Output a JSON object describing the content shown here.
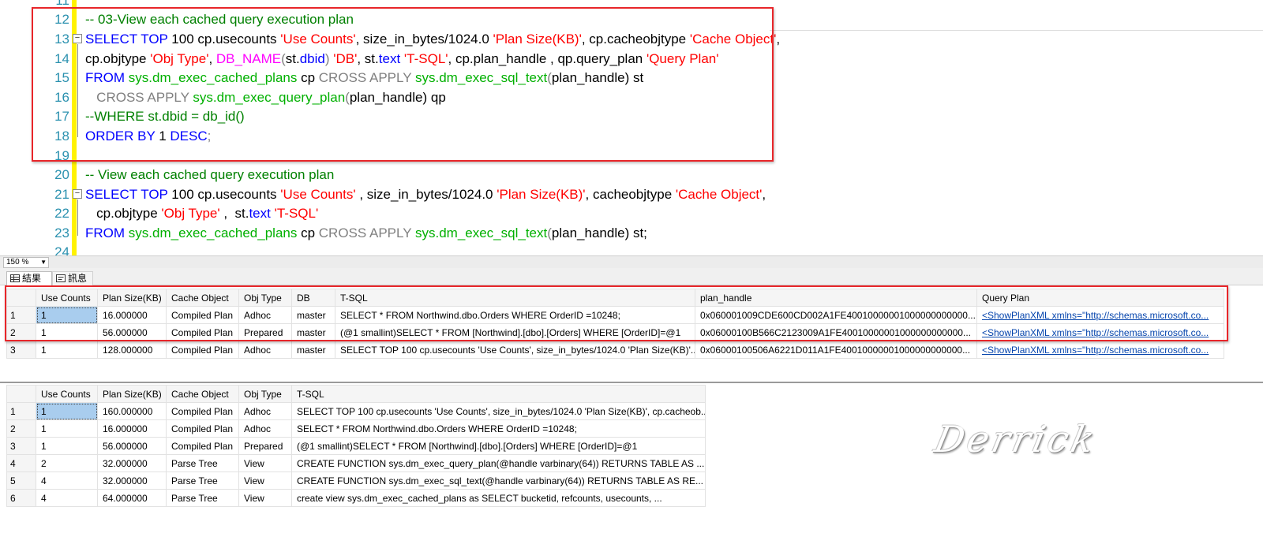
{
  "editor": {
    "line_numbers": [
      "11",
      "12",
      "13",
      "14",
      "15",
      "16",
      "17",
      "18",
      "19",
      "20",
      "21",
      "22",
      "23",
      "24"
    ],
    "lines": {
      "l12": {
        "c": "-- 03-View each cached query execution plan"
      },
      "l13": {
        "a": "SELECT TOP",
        "b": " 100 cp.usecounts ",
        "c": "'Use Counts'",
        "d": ", size_in_bytes/1024.0 ",
        "e": "'Plan Size(KB)'",
        "f": ", cp.cacheobjtype ",
        "g": "'Cache Object'",
        "h": ","
      },
      "l14": {
        "a": "cp.objtype ",
        "b": "'Obj Type'",
        "c": ", ",
        "d": "DB_NAME",
        "e": "(",
        "f": "st.",
        "g": "dbid",
        "h": ") ",
        "i": "'DB'",
        "j": ", st.",
        "k": "text",
        "l": " ",
        "m": "'T-SQL'",
        "n": ", cp.plan_handle , qp.query_plan ",
        "o": "'Query Plan'"
      },
      "l15": {
        "a": "FROM",
        "b": " ",
        "c": "sys.dm_exec_cached_plans",
        "d": " cp ",
        "e": "CROSS APPLY",
        "f": " ",
        "g": "sys.dm_exec_sql_text",
        "h": "(",
        "i": "plan_handle",
        "j": ") st"
      },
      "l16": {
        "a": "   CROSS APPLY",
        "b": " ",
        "c": "sys.dm_exec_query_plan",
        "d": "(",
        "e": "plan_handle",
        "f": ") qp"
      },
      "l17": {
        "c": "--WHERE st.dbid = db_id()"
      },
      "l18": {
        "a": "ORDER BY",
        "b": " 1 ",
        "c": "DESC",
        "d": ";"
      },
      "l20": {
        "c": "-- View each cached query execution plan"
      },
      "l21": {
        "a": "SELECT TOP",
        "b": " 100 cp.usecounts ",
        "c": "'Use Counts'",
        "d": " , size_in_bytes/1024.0 ",
        "e": "'Plan Size(KB)'",
        "f": ", cacheobjtype ",
        "g": "'Cache Object'",
        "h": ","
      },
      "l22": {
        "a": "   cp.objtype ",
        "b": "'Obj Type'",
        "c": " ,  st.",
        "d": "text",
        "e": " ",
        "f": "'T-SQL'"
      },
      "l23": {
        "a": "FROM",
        "b": " ",
        "c": "sys.dm_exec_cached_plans",
        "d": " cp ",
        "e": "CROSS APPLY",
        "f": " ",
        "g": "sys.dm_exec_sql_text",
        "h": "(",
        "i": "plan_handle",
        "j": ") st;"
      }
    }
  },
  "zoom": {
    "value": "150 %"
  },
  "tabs": {
    "results": "結果",
    "messages": "訊息"
  },
  "grid1": {
    "headers": [
      "",
      "Use Counts",
      "Plan Size(KB)",
      "Cache Object",
      "Obj Type",
      "DB",
      "T-SQL",
      "plan_handle",
      "Query Plan"
    ],
    "rows": [
      [
        "1",
        "1",
        "16.000000",
        "Compiled Plan",
        "Adhoc",
        "master",
        "SELECT * FROM Northwind.dbo.Orders WHERE OrderID =10248;",
        "0x060001009CDE600CD002A1FE40010000001000000000000...",
        "<ShowPlanXML xmlns=\"http://schemas.microsoft.co..."
      ],
      [
        "2",
        "1",
        "56.000000",
        "Compiled Plan",
        "Prepared",
        "master",
        "(@1 smallint)SELECT * FROM [Northwind].[dbo].[Orders] WHERE [OrderID]=@1",
        "0x06000100B566C2123009A1FE40010000001000000000000...",
        "<ShowPlanXML xmlns=\"http://schemas.microsoft.co..."
      ],
      [
        "3",
        "1",
        "128.000000",
        "Compiled Plan",
        "Adhoc",
        "master",
        "SELECT TOP 100 cp.usecounts 'Use Counts', size_in_bytes/1024.0 'Plan Size(KB)'...",
        "0x06000100506A6221D011A1FE40010000001000000000000...",
        "<ShowPlanXML xmlns=\"http://schemas.microsoft.co..."
      ]
    ]
  },
  "grid2": {
    "headers": [
      "",
      "Use Counts",
      "Plan Size(KB)",
      "Cache Object",
      "Obj Type",
      "T-SQL"
    ],
    "rows": [
      [
        "1",
        "1",
        "160.000000",
        "Compiled Plan",
        "Adhoc",
        "SELECT TOP 100 cp.usecounts 'Use Counts', size_in_bytes/1024.0 'Plan Size(KB)', cp.cacheob..."
      ],
      [
        "2",
        "1",
        "16.000000",
        "Compiled Plan",
        "Adhoc",
        "SELECT * FROM Northwind.dbo.Orders WHERE OrderID =10248;"
      ],
      [
        "3",
        "1",
        "56.000000",
        "Compiled Plan",
        "Prepared",
        "(@1 smallint)SELECT * FROM [Northwind].[dbo].[Orders] WHERE [OrderID]=@1"
      ],
      [
        "4",
        "2",
        "32.000000",
        "Parse Tree",
        "View",
        "CREATE FUNCTION sys.dm_exec_query_plan(@handle varbinary(64))  RETURNS TABLE  AS  ..."
      ],
      [
        "5",
        "4",
        "32.000000",
        "Parse Tree",
        "View",
        "CREATE FUNCTION sys.dm_exec_sql_text(@handle varbinary(64))  RETURNS TABLE  AS   RE..."
      ],
      [
        "6",
        "4",
        "64.000000",
        "Parse Tree",
        "View",
        "  create view sys.dm_exec_cached_plans as   SELECT   bucketid,   refcounts,   usecounts,   ..."
      ]
    ]
  },
  "watermark": "Derrick",
  "colors": {
    "highlight_box": "#e8262a",
    "selected_cell": "#a9cdee",
    "keyword": "#0000ff",
    "string": "#ff0000",
    "comment": "#008000",
    "system_object": "#00b000",
    "function": "#ff00ff",
    "line_number": "#2b91af"
  }
}
